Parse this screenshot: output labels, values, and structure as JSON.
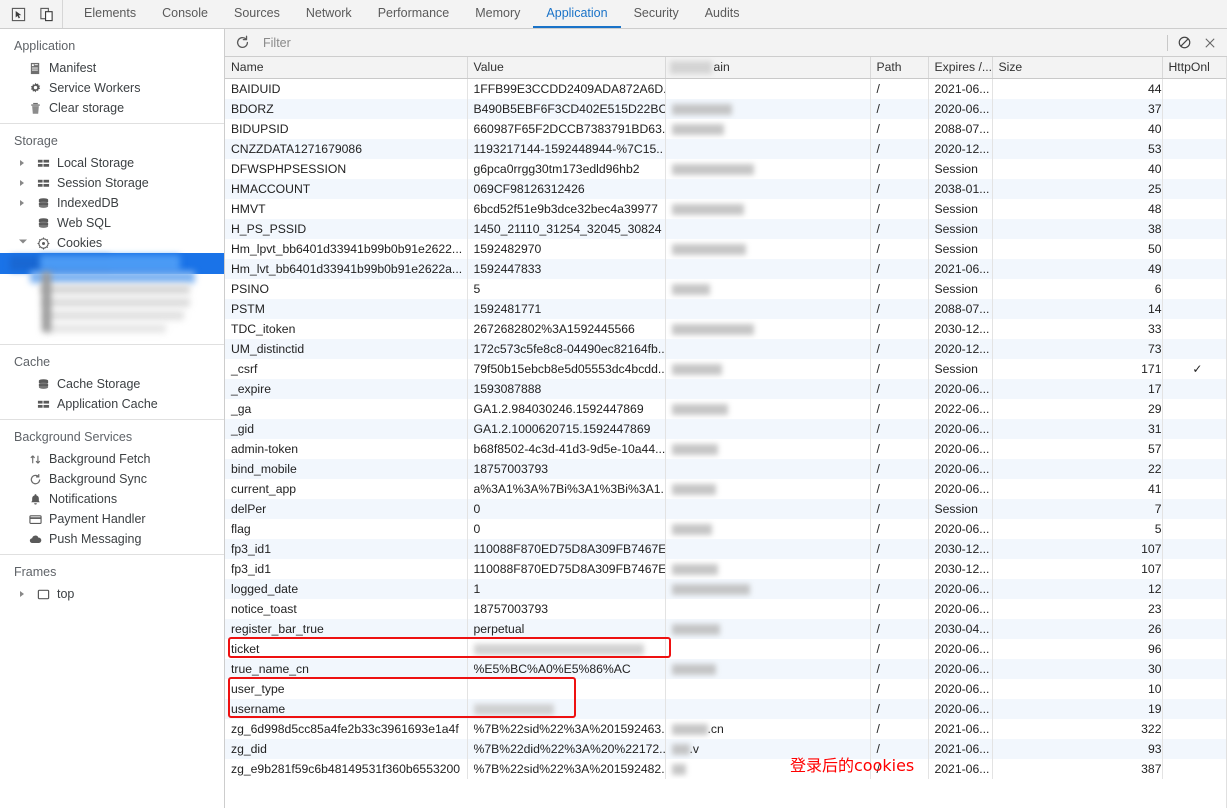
{
  "devtools": {
    "toolbar_icons": [
      "inspect-element-icon",
      "device-toolbar-icon"
    ],
    "tabs": [
      {
        "label": "Elements",
        "active": false
      },
      {
        "label": "Console",
        "active": false
      },
      {
        "label": "Sources",
        "active": false
      },
      {
        "label": "Network",
        "active": false
      },
      {
        "label": "Performance",
        "active": false
      },
      {
        "label": "Memory",
        "active": false
      },
      {
        "label": "Application",
        "active": true
      },
      {
        "label": "Security",
        "active": false
      },
      {
        "label": "Audits",
        "active": false
      }
    ],
    "accent_color": "#1a73c8",
    "selection_color": "#1a73e8",
    "annotation_color": "#ff0000"
  },
  "sidebar": {
    "groups": [
      {
        "title": "Application",
        "items": [
          {
            "label": "Manifest",
            "icon": "manifest-icon",
            "twisty": "none"
          },
          {
            "label": "Service Workers",
            "icon": "gear-icon",
            "twisty": "none"
          },
          {
            "label": "Clear storage",
            "icon": "trash-icon",
            "twisty": "none"
          }
        ]
      },
      {
        "title": "Storage",
        "items": [
          {
            "label": "Local Storage",
            "icon": "table-icon",
            "twisty": "closed"
          },
          {
            "label": "Session Storage",
            "icon": "table-icon",
            "twisty": "closed"
          },
          {
            "label": "IndexedDB",
            "icon": "database-icon",
            "twisty": "closed"
          },
          {
            "label": "Web SQL",
            "icon": "database-icon",
            "twisty": "none"
          },
          {
            "label": "Cookies",
            "icon": "cookie-icon",
            "twisty": "open"
          }
        ]
      },
      {
        "title": "Cache",
        "items": [
          {
            "label": "Cache Storage",
            "icon": "database-icon",
            "twisty": "none"
          },
          {
            "label": "Application Cache",
            "icon": "table-icon",
            "twisty": "none"
          }
        ]
      },
      {
        "title": "Background Services",
        "items": [
          {
            "label": "Background Fetch",
            "icon": "updown-arrow-icon",
            "twisty": "none"
          },
          {
            "label": "Background Sync",
            "icon": "sync-icon",
            "twisty": "none"
          },
          {
            "label": "Notifications",
            "icon": "bell-icon",
            "twisty": "none"
          },
          {
            "label": "Payment Handler",
            "icon": "card-icon",
            "twisty": "none"
          },
          {
            "label": "Push Messaging",
            "icon": "cloud-icon",
            "twisty": "none"
          }
        ]
      },
      {
        "title": "Frames",
        "items": [
          {
            "label": "top",
            "icon": "frame-icon",
            "twisty": "closed"
          }
        ]
      }
    ],
    "selected_item": {
      "label": "",
      "redacted": true,
      "note": "selected cookie domain (blurred)"
    }
  },
  "filterbar": {
    "refresh_icon": "refresh-icon",
    "placeholder": "Filter",
    "value": "",
    "clear_icon": "clear-all-icon",
    "close_icon": "close-icon"
  },
  "table": {
    "columns": [
      "Name",
      "Value",
      "ain",
      "Path",
      "Expires /...",
      "Size",
      "HttpOnl"
    ],
    "rows": [
      {
        "name": "BAIDUID",
        "value": "1FFB99E3CCDD2409ADA872A6D...",
        "domain_w": 0,
        "path": "/",
        "expires": "2021-06...",
        "size": "44",
        "httponly": ""
      },
      {
        "name": "BDORZ",
        "value": "B490B5EBF6F3CD402E515D22BC...",
        "domain_w": 60,
        "path": "/",
        "expires": "2020-06...",
        "size": "37",
        "httponly": ""
      },
      {
        "name": "BIDUPSID",
        "value": "660987F65F2DCCB7383791BD63...",
        "domain_w": 52,
        "path": "/",
        "expires": "2088-07...",
        "size": "40",
        "httponly": ""
      },
      {
        "name": "CNZZDATA1271679086",
        "value": "1193217144-1592448944-%7C15..",
        "domain_w": 0,
        "path": "/",
        "expires": "2020-12...",
        "size": "53",
        "httponly": ""
      },
      {
        "name": "DFWSPHPSESSION",
        "value": "g6pca0rrgg30tm173edld96hb2",
        "domain_w": 82,
        "path": "/",
        "expires": "Session",
        "size": "40",
        "httponly": ""
      },
      {
        "name": "HMACCOUNT",
        "value": "069CF98126312426",
        "domain_w": 0,
        "path": "/",
        "expires": "2038-01...",
        "size": "25",
        "httponly": ""
      },
      {
        "name": "HMVT",
        "value": "6bcd52f51e9b3dce32bec4a39977",
        "domain_w": 72,
        "path": "/",
        "expires": "Session",
        "size": "48",
        "httponly": ""
      },
      {
        "name": "H_PS_PSSID",
        "value": "1450_21110_31254_32045_30824",
        "domain_w": 0,
        "path": "/",
        "expires": "Session",
        "size": "38",
        "httponly": ""
      },
      {
        "name": "Hm_lpvt_bb6401d33941b99b0b91e2622...",
        "value": "1592482970",
        "domain_w": 74,
        "path": "/",
        "expires": "Session",
        "size": "50",
        "httponly": ""
      },
      {
        "name": "Hm_lvt_bb6401d33941b99b0b91e2622a...",
        "value": "1592447833",
        "domain_w": 0,
        "path": "/",
        "expires": "2021-06...",
        "size": "49",
        "httponly": ""
      },
      {
        "name": "PSINO",
        "value": "5",
        "domain_w": 38,
        "path": "/",
        "expires": "Session",
        "size": "6",
        "httponly": ""
      },
      {
        "name": "PSTM",
        "value": "1592481771",
        "domain_w": 0,
        "path": "/",
        "expires": "2088-07...",
        "size": "14",
        "httponly": ""
      },
      {
        "name": "TDC_itoken",
        "value": "2672682802%3A1592445566",
        "domain_w": 82,
        "path": "/",
        "expires": "2030-12...",
        "size": "33",
        "httponly": ""
      },
      {
        "name": "UM_distinctid",
        "value": "172c573c5fe8c8-04490ec82164fb..",
        "domain_w": 0,
        "path": "/",
        "expires": "2020-12...",
        "size": "73",
        "httponly": ""
      },
      {
        "name": "_csrf",
        "value": "79f50b15ebcb8e5d05553dc4bcdd...",
        "domain_w": 50,
        "path": "/",
        "expires": "Session",
        "size": "171",
        "httponly": "✓"
      },
      {
        "name": "_expire",
        "value": "1593087888",
        "domain_w": 0,
        "path": "/",
        "expires": "2020-06...",
        "size": "17",
        "httponly": ""
      },
      {
        "name": "_ga",
        "value": "GA1.2.984030246.1592447869",
        "domain_w": 56,
        "path": "/",
        "expires": "2022-06...",
        "size": "29",
        "httponly": ""
      },
      {
        "name": "_gid",
        "value": "GA1.2.1000620715.1592447869",
        "domain_w": 0,
        "path": "/",
        "expires": "2020-06...",
        "size": "31",
        "httponly": ""
      },
      {
        "name": "admin-token",
        "value": "b68f8502-4c3d-41d3-9d5e-10a44...",
        "domain_w": 46,
        "path": "/",
        "expires": "2020-06...",
        "size": "57",
        "httponly": ""
      },
      {
        "name": "bind_mobile",
        "value": "18757003793",
        "domain_w": 0,
        "path": "/",
        "expires": "2020-06...",
        "size": "22",
        "httponly": ""
      },
      {
        "name": "current_app",
        "value": "a%3A1%3A%7Bi%3A1%3Bi%3A1...",
        "domain_w": 44,
        "path": "/",
        "expires": "2020-06...",
        "size": "41",
        "httponly": ""
      },
      {
        "name": "delPer",
        "value": "0",
        "domain_w": 0,
        "path": "/",
        "expires": "Session",
        "size": "7",
        "httponly": ""
      },
      {
        "name": "flag",
        "value": "0",
        "domain_w": 40,
        "path": "/",
        "expires": "2020-06...",
        "size": "5",
        "httponly": ""
      },
      {
        "name": "fp3_id1",
        "value": "110088F870ED75D8A309FB7467E...",
        "domain_w": 0,
        "path": "/",
        "expires": "2030-12...",
        "size": "107",
        "httponly": ""
      },
      {
        "name": "fp3_id1",
        "value": "110088F870ED75D8A309FB7467E...",
        "domain_w": 46,
        "path": "/",
        "expires": "2030-12...",
        "size": "107",
        "httponly": ""
      },
      {
        "name": "logged_date",
        "value": "1",
        "domain_w": 78,
        "path": "/",
        "expires": "2020-06...",
        "size": "12",
        "httponly": ""
      },
      {
        "name": "notice_toast",
        "value": "18757003793",
        "domain_w": 0,
        "path": "/",
        "expires": "2020-06...",
        "size": "23",
        "httponly": ""
      },
      {
        "name": "register_bar_true",
        "value": "perpetual",
        "domain_w": 48,
        "path": "/",
        "expires": "2030-04...",
        "size": "26",
        "httponly": ""
      },
      {
        "name": "ticket",
        "value": "",
        "value_blur_w": 170,
        "domain_w": 0,
        "path": "/",
        "expires": "2020-06...",
        "size": "96",
        "httponly": ""
      },
      {
        "name": "true_name_cn",
        "value": "%E5%BC%A0%E5%86%AC",
        "domain_w": 44,
        "path": "/",
        "expires": "2020-06...",
        "size": "30",
        "httponly": ""
      },
      {
        "name": "user_type",
        "value": "",
        "value_blur_w": 0,
        "domain_w": 0,
        "path": "/",
        "expires": "2020-06...",
        "size": "10",
        "httponly": ""
      },
      {
        "name": "username",
        "value": "",
        "value_blur_w": 80,
        "domain_w": 0,
        "path": "/",
        "expires": "2020-06...",
        "size": "19",
        "httponly": ""
      },
      {
        "name": "zg_6d998d5cc85a4fe2b33c3961693e1a4f",
        "value": "%7B%22sid%22%3A%201592463...",
        "domain_w": 36,
        "domain_text": ".cn",
        "path": "/",
        "expires": "2021-06...",
        "size": "322",
        "httponly": ""
      },
      {
        "name": "zg_did",
        "value": "%7B%22did%22%3A%20%22172...",
        "domain_w": 18,
        "domain_text": ".v",
        "path": "/",
        "expires": "2021-06...",
        "size": "93",
        "httponly": ""
      },
      {
        "name": "zg_e9b281f59c6b48149531f360b6553200",
        "value": "%7B%22sid%22%3A%201592482...",
        "domain_w": 14,
        "path": "/",
        "expires": "2021-06...",
        "size": "387",
        "httponly": ""
      }
    ]
  },
  "annotations": {
    "caption": "登录后的cookies",
    "highlight_rows": [
      "ticket",
      "user_type",
      "username"
    ]
  }
}
